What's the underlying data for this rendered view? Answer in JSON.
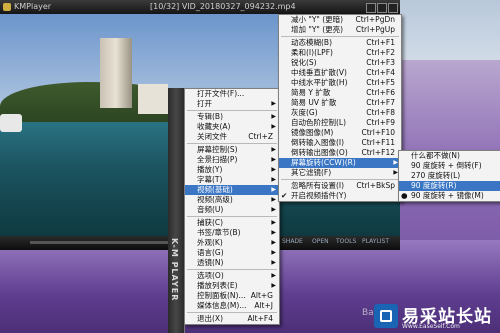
{
  "titlebar": {
    "app": "KMPlayer",
    "title": "[10/32] VID_20180327_094232.mp4"
  },
  "controlbar": {
    "labels": [
      "SHADE",
      "OPEN",
      "TOOLS",
      "PLAYLIST"
    ]
  },
  "banner": {
    "text": "K-M PLAYER"
  },
  "context_menu": {
    "items": [
      {
        "label": "打开文件(F)...",
        "shortcut": "",
        "arrow": false
      },
      {
        "label": "打开",
        "shortcut": "",
        "arrow": true
      },
      {
        "sep": true
      },
      {
        "label": "专辑(B)",
        "shortcut": "",
        "arrow": true
      },
      {
        "label": "收藏夹(A)",
        "shortcut": "",
        "arrow": true
      },
      {
        "label": "关闭文件",
        "shortcut": "Ctrl+Z",
        "arrow": false
      },
      {
        "sep": true
      },
      {
        "label": "屏幕控制(S)",
        "shortcut": "",
        "arrow": true
      },
      {
        "label": "全景扫描(P)",
        "shortcut": "",
        "arrow": true
      },
      {
        "label": "播放(Y)",
        "shortcut": "",
        "arrow": true
      },
      {
        "label": "字幕(T)",
        "shortcut": "",
        "arrow": true
      },
      {
        "label": "视频(基础)",
        "shortcut": "",
        "arrow": true,
        "highlight": true
      },
      {
        "label": "视频(高级)",
        "shortcut": "",
        "arrow": true
      },
      {
        "label": "音频(U)",
        "shortcut": "",
        "arrow": true
      },
      {
        "sep": true
      },
      {
        "label": "捕获(C)",
        "shortcut": "",
        "arrow": true
      },
      {
        "label": "书签/章节(B)",
        "shortcut": "",
        "arrow": true
      },
      {
        "label": "外观(K)",
        "shortcut": "",
        "arrow": true
      },
      {
        "label": "语言(G)",
        "shortcut": "",
        "arrow": true
      },
      {
        "label": "透镜(N)",
        "shortcut": "",
        "arrow": true
      },
      {
        "sep": true
      },
      {
        "label": "选项(O)",
        "shortcut": "",
        "arrow": true
      },
      {
        "label": "播放列表(E)",
        "shortcut": "",
        "arrow": true
      },
      {
        "label": "控制面板(N)...",
        "shortcut": "Alt+G",
        "arrow": false
      },
      {
        "label": "媒体信息(M)...",
        "shortcut": "Alt+J",
        "arrow": false
      },
      {
        "sep": true
      },
      {
        "label": "退出(X)",
        "shortcut": "Alt+F4",
        "arrow": false
      }
    ]
  },
  "video_menu": {
    "items": [
      {
        "label": "减小 \"Y\" (更暗)",
        "shortcut": "Ctrl+PgDn"
      },
      {
        "label": "增加 \"Y\" (更亮)",
        "shortcut": "Ctrl+PgUp"
      },
      {
        "sep": true
      },
      {
        "label": "动态模糊(B)",
        "shortcut": "Ctrl+F1"
      },
      {
        "label": "柔和(I)(LPF)",
        "shortcut": "Ctrl+F2"
      },
      {
        "label": "锐化(S)",
        "shortcut": "Ctrl+F3"
      },
      {
        "label": "中线垂直扩散(V)",
        "shortcut": "Ctrl+F4"
      },
      {
        "label": "中线水平扩散(H)",
        "shortcut": "Ctrl+F5"
      },
      {
        "label": "简易 Y 扩散",
        "shortcut": "Ctrl+F6"
      },
      {
        "label": "简易 UV 扩散",
        "shortcut": "Ctrl+F7"
      },
      {
        "label": "灰度(G)",
        "shortcut": "Ctrl+F8"
      },
      {
        "label": "自动色阶控制(L)",
        "shortcut": "Ctrl+F9"
      },
      {
        "label": "镜像图像(M)",
        "shortcut": "Ctrl+F10"
      },
      {
        "label": "倒转输入图像(I)",
        "shortcut": "Ctrl+F11"
      },
      {
        "label": "倒转输出图像(O)",
        "shortcut": "Ctrl+F12"
      },
      {
        "label": "屏幕旋转(CCW)(R)",
        "shortcut": "",
        "arrow": true,
        "highlight": true
      },
      {
        "label": "其它滤镜(F)",
        "shortcut": "",
        "arrow": true
      },
      {
        "sep": true
      },
      {
        "label": "忽略所有设置(I)",
        "shortcut": "Ctrl+BkSp"
      },
      {
        "label": "开启视频插件(Y)",
        "shortcut": "",
        "check": true
      }
    ]
  },
  "rotate_menu": {
    "items": [
      {
        "label": "什么都不做(N)"
      },
      {
        "label": "90 度旋转 + 倒转(F)"
      },
      {
        "label": "270 度旋转(L)"
      },
      {
        "label": "90 度旋转(R)",
        "highlight": true
      },
      {
        "label": "90 度旋转 + 镜像(M)",
        "check": true
      }
    ]
  },
  "watermark": {
    "title": "易采站长站",
    "sub": "Www.EaseSelf.Com",
    "baidu": "Bai du"
  }
}
